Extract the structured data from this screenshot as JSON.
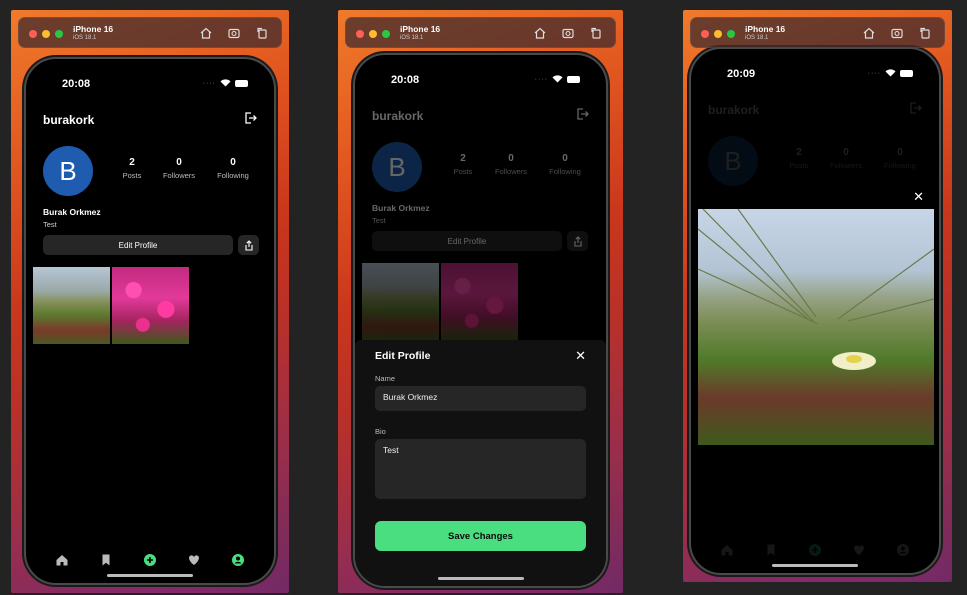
{
  "simulator": {
    "device_name": "iPhone 16",
    "os_version": "iOS 18.1"
  },
  "screens": [
    {
      "time": "20:08"
    },
    {
      "time": "20:08"
    },
    {
      "time": "20:09"
    }
  ],
  "profile": {
    "username": "burakork",
    "avatar_letter": "B",
    "full_name": "Burak Orkmez",
    "bio": "Test",
    "stats": [
      {
        "value": "2",
        "label": "Posts"
      },
      {
        "value": "0",
        "label": "Followers"
      },
      {
        "value": "0",
        "label": "Following"
      }
    ],
    "edit_button_label": "Edit Profile"
  },
  "edit_sheet": {
    "title": "Edit Profile",
    "close_glyph": "✕",
    "name_label": "Name",
    "name_value": "Burak Orkmez",
    "bio_label": "Bio",
    "bio_value": "Test",
    "save_label": "Save Changes"
  },
  "viewer": {
    "close_glyph": "✕"
  },
  "tabbar": {
    "items": [
      "home-icon",
      "bookmark-icon",
      "add-post-icon",
      "heart-icon",
      "profile-icon"
    ],
    "accent": "#4ade80"
  },
  "colors": {
    "avatar": "#1f5cb0",
    "save_button": "#4ade80"
  }
}
